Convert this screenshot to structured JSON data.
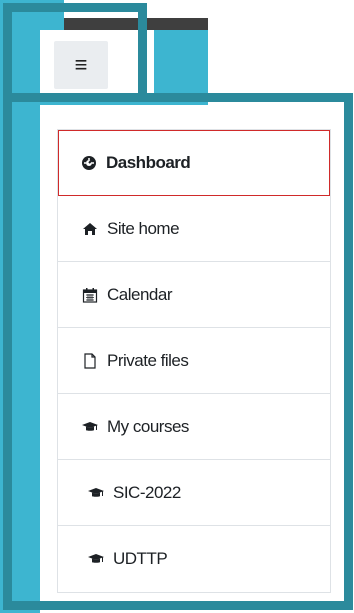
{
  "header": {
    "menu_icon": "hamburger-menu-icon",
    "menu_glyph": "≡"
  },
  "nav": {
    "items": [
      {
        "label": "Dashboard",
        "icon": "dashboard-icon",
        "active": true
      },
      {
        "label": "Site home",
        "icon": "home-icon"
      },
      {
        "label": "Calendar",
        "icon": "calendar-icon"
      },
      {
        "label": "Private files",
        "icon": "file-icon"
      },
      {
        "label": "My courses",
        "icon": "graduation-cap-icon"
      },
      {
        "label": "SIC-2022",
        "icon": "graduation-cap-icon",
        "indent": true
      },
      {
        "label": "UDTTP",
        "icon": "graduation-cap-icon",
        "indent": true
      }
    ]
  },
  "colors": {
    "accent_highlight": "#2b8a9c",
    "active_border": "#d02a2a",
    "side_bg": "#3db5d0"
  }
}
